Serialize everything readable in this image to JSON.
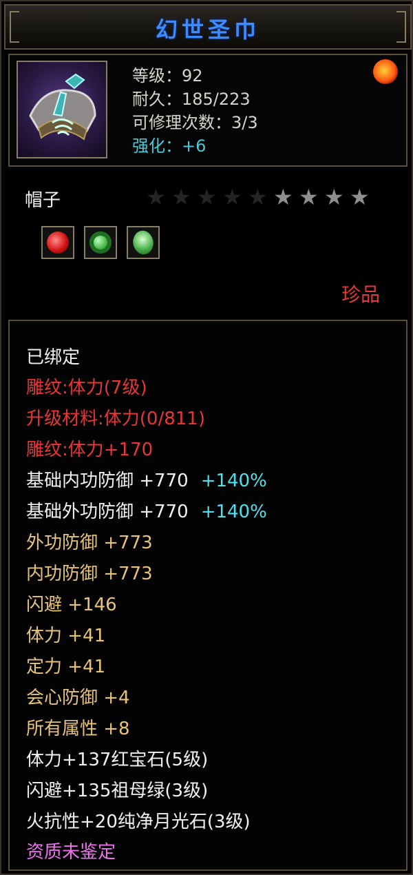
{
  "title": "幻世圣巾",
  "header": {
    "level": "等级：92",
    "durability": "耐久：185/223",
    "repairs": "可修理次数：3/3",
    "enhance": "强化：+6",
    "item_icon": "helmet-icon",
    "orb_icon": "fire-orb-icon"
  },
  "type_label": "帽子",
  "stars": {
    "total": 9,
    "lit": 4
  },
  "gems": [
    {
      "icon": "ruby-gem-icon"
    },
    {
      "icon": "emerald-ring-gem-icon"
    },
    {
      "icon": "emerald-gem-icon"
    }
  ],
  "rarity": "珍品",
  "attributes": {
    "bound": "已绑定",
    "engrave1": "雕纹:体力(7级)",
    "upgrade_material": "升级材料:体力(0/811)",
    "engrave2": "雕纹:体力+170",
    "base_inner_def": "基础内功防御  +770",
    "base_inner_pct": "+140%",
    "base_outer_def": "基础外功防御  +770",
    "base_outer_pct": "+140%",
    "outer_def": "外功防御  +773",
    "inner_def": "内功防御  +773",
    "dodge": "闪避  +146",
    "stamina": "体力  +41",
    "focus": "定力  +41",
    "crit_def": "会心防御  +4",
    "all_attr": "所有属性  +8",
    "gem_ruby": "体力+137红宝石(5级)",
    "gem_emerald": "闪避+135祖母绿(3级)",
    "gem_moonstone": "火抗性+20纯净月光石(3级)",
    "aptitude": "资质未鉴定"
  },
  "colors": {
    "title": "#3d8bff",
    "red": "#e83636",
    "gold": "#e8c37a",
    "cyan": "#52e0f0",
    "pink": "#ee72ee"
  }
}
